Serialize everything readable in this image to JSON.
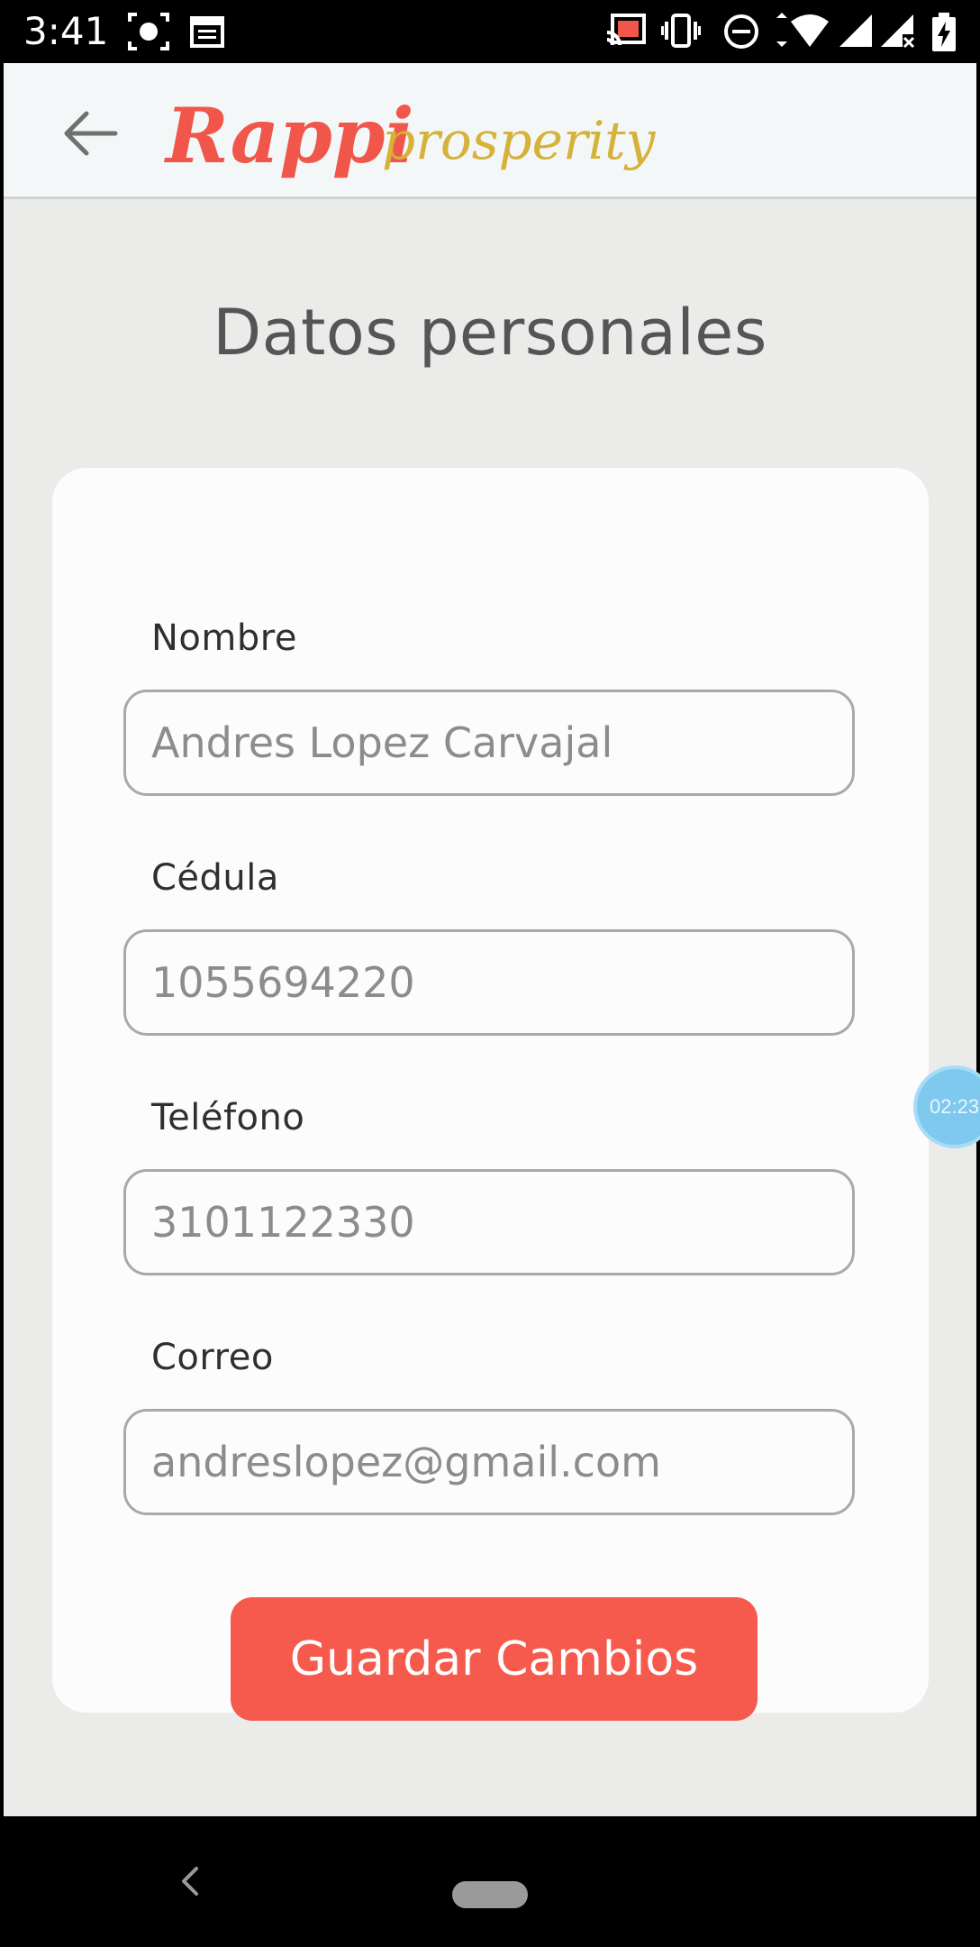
{
  "status_bar": {
    "time": "3:41",
    "icons": [
      "screenshot-icon",
      "calendar-icon",
      "cast-icon",
      "vibrate-icon",
      "do-not-disturb-icon",
      "wifi-icon",
      "signal-icon",
      "battery-charging-icon"
    ]
  },
  "header": {
    "back_icon": "arrow-left-icon",
    "logo_primary": "Rappi",
    "logo_secondary": "prosperity",
    "logo_primary_color": "#f0564a",
    "logo_secondary_color": "#d6b239"
  },
  "page": {
    "title": "Datos personales"
  },
  "form": {
    "fields": [
      {
        "label": "Nombre",
        "placeholder": "Andres Lopez Carvajal"
      },
      {
        "label": "Cédula",
        "placeholder": "1055694220"
      },
      {
        "label": "Teléfono",
        "placeholder": "3101122330"
      },
      {
        "label": "Correo",
        "placeholder": "andreslopez@gmail.com"
      }
    ],
    "save_label": "Guardar Cambios",
    "accent_color": "#f55a4d"
  },
  "overlay": {
    "timer": "02:23"
  },
  "nav_bar": {
    "back_icon": "triangle-back-icon",
    "home_icon": "home-pill-icon"
  }
}
